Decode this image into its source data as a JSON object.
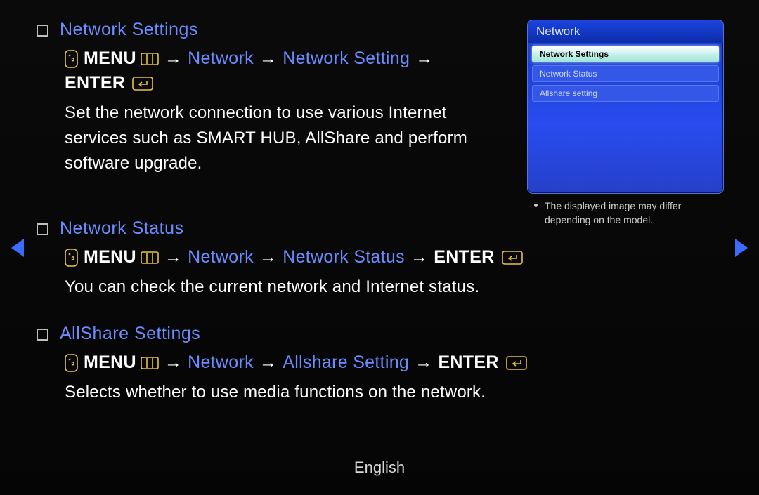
{
  "arrow_sep": "→",
  "keywords": {
    "menu": "MENU",
    "enter": "ENTER"
  },
  "sections": [
    {
      "title": "Network Settings",
      "path_links": [
        "Network",
        "Network Setting"
      ],
      "enter_wraps": true,
      "description": "Set the network connection to use various Internet services such as SMART HUB, AllShare and perform software upgrade."
    },
    {
      "title": "Network Status",
      "path_links": [
        "Network",
        "Network Status"
      ],
      "enter_wraps": false,
      "description": "You can check the current network and Internet status."
    },
    {
      "title": "AllShare Settings",
      "path_links": [
        "Network",
        "Allshare Setting"
      ],
      "enter_wraps": false,
      "description": "Selects whether to use media functions on the network."
    }
  ],
  "panel": {
    "header": "Network",
    "items": [
      {
        "label": "Network Settings",
        "selected": true
      },
      {
        "label": "Network Status",
        "selected": false
      },
      {
        "label": "Allshare setting",
        "selected": false
      }
    ],
    "note": "The displayed image may differ depending on the model."
  },
  "footer": {
    "language": "English"
  }
}
